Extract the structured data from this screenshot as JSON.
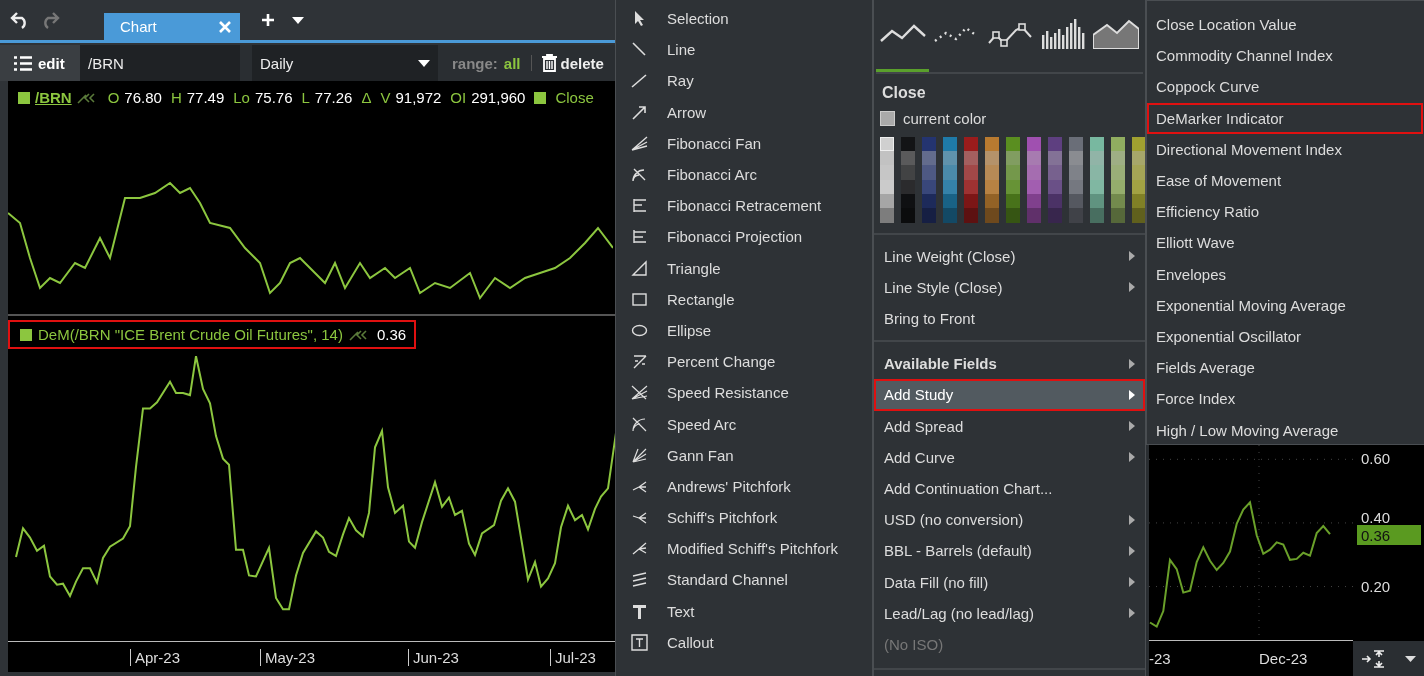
{
  "tab_bar": {
    "tabs": [
      {
        "label": "Chart",
        "selected": true
      }
    ],
    "undo_enabled": true,
    "redo_enabled": false
  },
  "toolbar": {
    "edit_label": "edit",
    "symbol": "/BRN",
    "interval": "Daily",
    "range_label": "range:",
    "range_value": "all",
    "delete_label": "delete"
  },
  "price_legend": {
    "symbol": "/BRN",
    "fields": [
      {
        "key": "O",
        "value": "76.80"
      },
      {
        "key": "H",
        "value": "77.49"
      },
      {
        "key": "Lo",
        "value": "75.76"
      },
      {
        "key": "L",
        "value": "77.26"
      },
      {
        "key": "Δ"
      },
      {
        "key": "V",
        "value": "91,972"
      },
      {
        "key": "OI",
        "value": "291,960"
      }
    ],
    "series_label": "Close"
  },
  "study_legend": {
    "text": "DeM(/BRN \"ICE Brent Crude Oil Futures\", 14)",
    "value": "0.36",
    "highlighted": true
  },
  "x_axis_labels": [
    "Apr-23",
    "May-23",
    "Jun-23",
    "Jul-23"
  ],
  "drawing_tools": [
    {
      "label": "Selection"
    },
    {
      "label": "Line"
    },
    {
      "label": "Ray"
    },
    {
      "label": "Arrow"
    },
    {
      "label": "Fibonacci Fan"
    },
    {
      "label": "Fibonacci Arc"
    },
    {
      "label": "Fibonacci Retracement"
    },
    {
      "label": "Fibonacci Projection"
    },
    {
      "label": "Triangle"
    },
    {
      "label": "Rectangle"
    },
    {
      "label": "Ellipse"
    },
    {
      "label": "Percent Change"
    },
    {
      "label": "Speed Resistance"
    },
    {
      "label": "Speed Arc"
    },
    {
      "label": "Gann Fan"
    },
    {
      "label": "Andrews' Pitchfork"
    },
    {
      "label": "Schiff's Pitchfork"
    },
    {
      "label": "Modified Schiff's Pitchfork"
    },
    {
      "label": "Standard Channel"
    },
    {
      "label": "Text"
    },
    {
      "label": "Callout"
    }
  ],
  "style_tabs": [
    {
      "kind": "line",
      "selected": true
    },
    {
      "kind": "dots",
      "selected": false
    },
    {
      "kind": "markers",
      "selected": false
    },
    {
      "kind": "bars",
      "selected": false
    },
    {
      "kind": "area",
      "selected": false
    }
  ],
  "color_section": {
    "title": "Close",
    "current_color_label": "current color"
  },
  "palette": [
    {
      "color": "#d0d0d0",
      "selected": true
    },
    {
      "color": "#131416",
      "selected": false
    },
    {
      "color": "#243470",
      "selected": false
    },
    {
      "color": "#1f7aa8",
      "selected": false
    },
    {
      "color": "#9b1c1c",
      "selected": false
    },
    {
      "color": "#b87a30",
      "selected": false
    },
    {
      "color": "#5a8e20",
      "selected": false
    },
    {
      "color": "#a050b0",
      "selected": false
    },
    {
      "color": "#5e3f80",
      "selected": false
    },
    {
      "color": "#6a6e78",
      "selected": false
    },
    {
      "color": "#78b8a0",
      "selected": false
    },
    {
      "color": "#90ad60",
      "selected": false
    },
    {
      "color": "#a0a030",
      "selected": false
    }
  ],
  "context_menu": [
    [
      {
        "label": "Line Weight (Close)",
        "kind": "item",
        "submenu": true,
        "disabled": false,
        "selected": false,
        "highlighted": false
      },
      {
        "label": "Line Style (Close)",
        "kind": "item",
        "submenu": true,
        "disabled": false,
        "selected": false,
        "highlighted": false
      },
      {
        "label": "Bring to Front",
        "kind": "item",
        "submenu": false,
        "disabled": false,
        "selected": false,
        "highlighted": false
      }
    ],
    [
      {
        "label": "Available Fields",
        "kind": "header",
        "submenu": true,
        "disabled": false,
        "selected": false,
        "highlighted": false
      },
      {
        "label": "Add Study",
        "kind": "item",
        "submenu": true,
        "disabled": false,
        "selected": true,
        "highlighted": true
      },
      {
        "label": "Add Spread",
        "kind": "item",
        "submenu": true,
        "disabled": false,
        "selected": false,
        "highlighted": false
      },
      {
        "label": "Add Curve",
        "kind": "item",
        "submenu": true,
        "disabled": false,
        "selected": false,
        "highlighted": false
      },
      {
        "label": "Add Continuation Chart...",
        "kind": "item",
        "submenu": false,
        "disabled": false,
        "selected": false,
        "highlighted": false
      },
      {
        "label": "USD (no conversion)",
        "kind": "item",
        "submenu": true,
        "disabled": false,
        "selected": false,
        "highlighted": false
      },
      {
        "label": "BBL - Barrels (default)",
        "kind": "item",
        "submenu": true,
        "disabled": false,
        "selected": false,
        "highlighted": false
      },
      {
        "label": "Data Fill (no fill)",
        "kind": "item",
        "submenu": true,
        "disabled": false,
        "selected": false,
        "highlighted": false
      },
      {
        "label": "Lead/Lag (no lead/lag)",
        "kind": "item",
        "submenu": true,
        "disabled": false,
        "selected": false,
        "highlighted": false
      },
      {
        "label": "(No ISO)",
        "kind": "item",
        "submenu": false,
        "disabled": true,
        "selected": false,
        "highlighted": false
      }
    ]
  ],
  "study_submenu": [
    {
      "label": "Close Location Value",
      "highlighted": false
    },
    {
      "label": "Commodity Channel Index",
      "highlighted": false
    },
    {
      "label": "Coppock Curve",
      "highlighted": false
    },
    {
      "label": "DeMarker Indicator",
      "highlighted": true
    },
    {
      "label": "Directional Movement Index",
      "highlighted": false
    },
    {
      "label": "Ease of Movement",
      "highlighted": false
    },
    {
      "label": "Efficiency Ratio",
      "highlighted": false
    },
    {
      "label": "Elliott Wave",
      "highlighted": false
    },
    {
      "label": "Envelopes",
      "highlighted": false
    },
    {
      "label": "Exponential Moving Average",
      "highlighted": false
    },
    {
      "label": "Exponential Oscillator",
      "highlighted": false
    },
    {
      "label": "Fields Average",
      "highlighted": false
    },
    {
      "label": "Force Index",
      "highlighted": false
    },
    {
      "label": "High / Low Moving Average",
      "highlighted": false
    }
  ],
  "right_chart": {
    "current_value": "0.36",
    "x_labels": [
      "-23",
      "Dec-23"
    ],
    "chart_data": {
      "type": "line",
      "categories": [
        null,
        null,
        null,
        null,
        null,
        null,
        null,
        null,
        null,
        null,
        null,
        null,
        null,
        null,
        null,
        null,
        null,
        null,
        null,
        null,
        null,
        null,
        null,
        null,
        null,
        null,
        null,
        null
      ],
      "series": [
        {
          "color": "#6aa02a",
          "values": [
            0.087,
            0.074,
            0.123,
            0.284,
            0.255,
            0.181,
            0.187,
            0.277,
            0.323,
            0.281,
            0.252,
            0.274,
            0.31,
            0.397,
            0.442,
            0.465,
            0.361,
            0.303,
            0.316,
            0.339,
            0.332,
            0.284,
            0.287,
            0.306,
            0.297,
            0.368,
            0.39,
            0.365
          ]
        }
      ],
      "ylim": [
        0.032,
        0.645
      ],
      "grid": true,
      "yticks": [
        {
          "value": 0.6,
          "label": "0.60"
        },
        {
          "value": 0.4,
          "label": "0.40"
        },
        {
          "value": 0.2,
          "label": "0.20"
        }
      ]
    }
  }
}
